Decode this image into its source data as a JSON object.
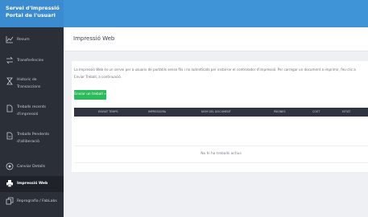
{
  "brand": {
    "line1": "Servei d'Impressió",
    "line2": "Portal de l'usuari"
  },
  "sidebar": {
    "items": [
      {
        "label": "Resum",
        "icon": "chart-line-icon",
        "active": false
      },
      {
        "label": "Transferències",
        "icon": "transfer-arrows-icon",
        "active": false
      },
      {
        "label": "Historic de",
        "label2": "Transaccions",
        "icon": "hourglass-icon",
        "active": false
      },
      {
        "label": "Treballs recents",
        "label2": "d'impressió",
        "icon": "document-icon",
        "active": false
      },
      {
        "label": "Treballs Pendents",
        "label2": "d'alliberació",
        "icon": "document-pending-icon",
        "active": false
      },
      {
        "label": "Canviar Detalls",
        "icon": "user-settings-icon",
        "active": false
      },
      {
        "label": "Impressió Web",
        "icon": "printer-icon",
        "active": true
      },
      {
        "label": "Reprografia / FabLabs",
        "icon": "copy-icon",
        "active": false
      }
    ]
  },
  "page": {
    "title": "Impressió Web",
    "description": "La Impressió Web és un servei per a usuaris de portàtils sense fils i no autenticats per instal·lar el controlador d'impressió. Per carregar un document a imprimir, feu clic a Enviar Treball, a continuació.",
    "send_button": "Enviar un treball »",
    "table": {
      "columns": [
        "ENVIAT TEMPS",
        "IMPRESSORA",
        "NOM DEL DOCUMENT",
        "PÀGINES",
        "COST",
        "ESTAT"
      ]
    },
    "empty_message": "No hi ha treballs actius"
  },
  "colors": {
    "topbar": "#3f93d7",
    "sidebar": "#2b2f38",
    "table_header": "#2f3440",
    "send_button": "#2bbb5a"
  }
}
